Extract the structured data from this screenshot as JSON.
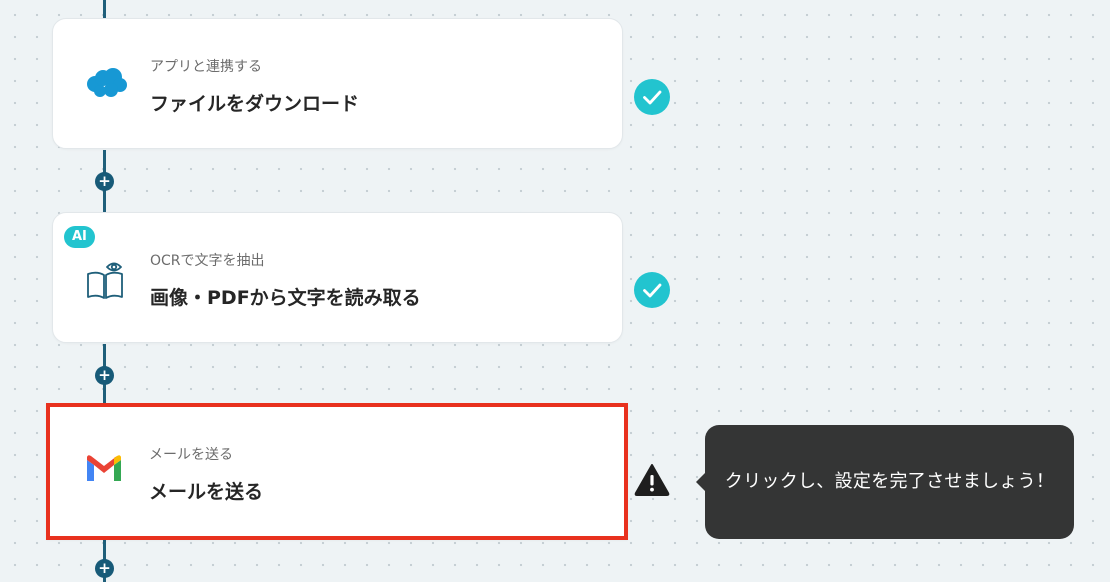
{
  "flow": {
    "steps": [
      {
        "subtitle": "アプリと連携する",
        "title": "ファイルをダウンロード",
        "icon": "salesforce-cloud-icon",
        "status": "complete",
        "status_icon": "check-icon"
      },
      {
        "badge": "AI",
        "subtitle": "OCRで文字を抽出",
        "title": "画像・PDFから文字を読み取る",
        "icon": "book-eye-ocr-icon",
        "status": "complete",
        "status_icon": "check-icon"
      },
      {
        "subtitle": "メールを送る",
        "title": "メールを送る",
        "icon": "gmail-icon",
        "status": "warning",
        "status_icon": "warning-icon",
        "selected": true
      }
    ],
    "add_step_symbol": "+"
  },
  "tooltip": {
    "text": "クリックし、設定を完了させましょう！"
  },
  "colors": {
    "background": "#eef3f5",
    "connector": "#1f5f7a",
    "check": "#22c4cf",
    "selected_border": "#e8311e",
    "tooltip_bg": "#343535",
    "ai_badge": "#22c4cf"
  }
}
